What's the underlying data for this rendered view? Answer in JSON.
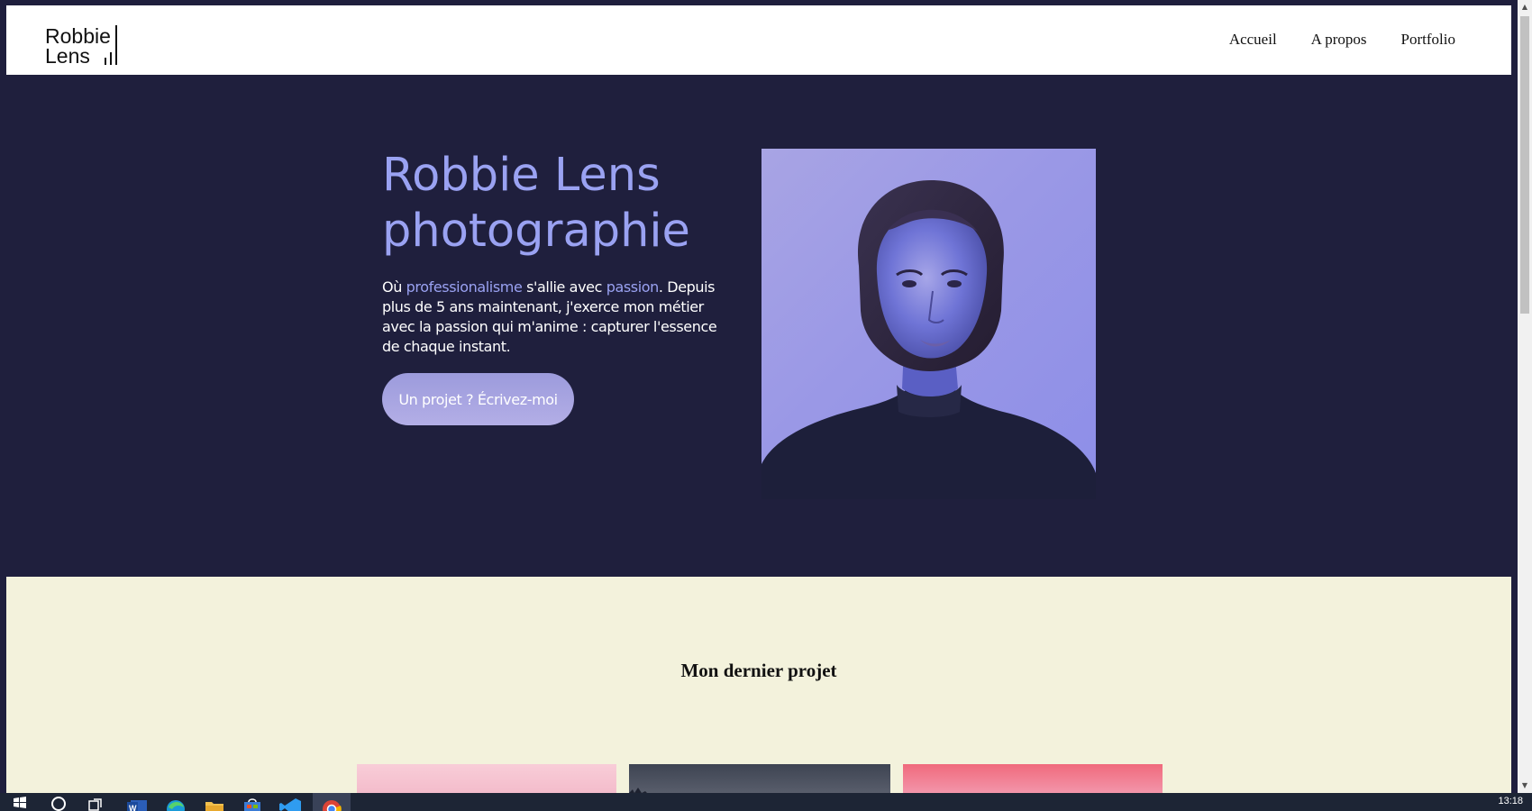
{
  "header": {
    "logo": {
      "line1": "Robbie",
      "line2": "Lens"
    },
    "nav": [
      "Accueil",
      "A propos",
      "Portfolio"
    ]
  },
  "hero": {
    "title_line1": "Robbie Lens",
    "title_line2": "photographie",
    "text_parts": {
      "p1": "Où ",
      "h1": "professionalisme",
      "p2": " s'allie avec ",
      "h2": "passion",
      "p3": ". Depuis plus de 5 ans maintenant, j'exerce mon métier avec la passion qui m'anime : capturer l'essence de chaque instant."
    },
    "cta_label": "Un projet ? Écrivez-moi"
  },
  "project": {
    "heading": "Mon dernier projet"
  },
  "taskbar": {
    "icons": [
      "windows-start-icon",
      "search-icon",
      "task-view-icon",
      "word-icon",
      "edge-icon",
      "file-explorer-icon",
      "store-icon",
      "vscode-icon",
      "chrome-icon"
    ],
    "clock": "13:18"
  },
  "colors": {
    "dark_bg": "#1f1f3d",
    "accent": "#9aa2f2",
    "project_bg": "#f3f2dc",
    "cta_gradient_top": "#9c9bdc",
    "cta_gradient_bottom": "#b3aee6"
  }
}
